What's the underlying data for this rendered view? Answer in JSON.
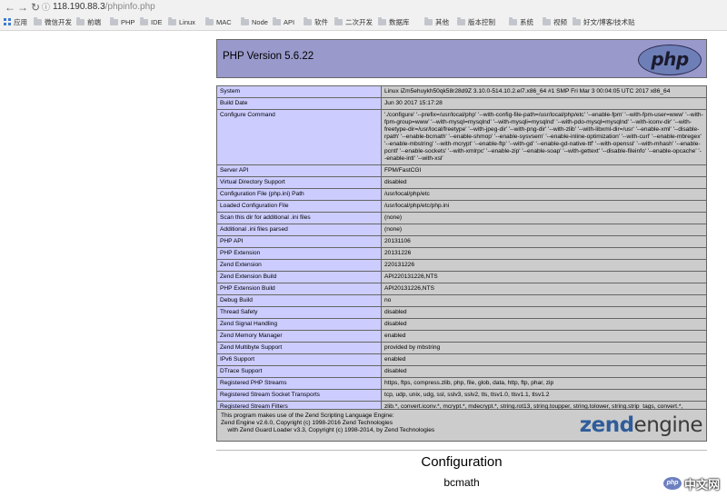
{
  "browser": {
    "url_host": "118.190.88.3",
    "url_path": "/phpinfo.php",
    "bookmarks": [
      "应用",
      "微信开发",
      "前端",
      "PHP",
      "IDE",
      "Linux",
      "MAC",
      "Node",
      "API",
      "软件",
      "二次开发",
      "数据库",
      "其他",
      "版本控制",
      "系统",
      "视频",
      "好文/博客/技术贴"
    ]
  },
  "header": {
    "version": "PHP Version 5.6.22",
    "logo_text": "php"
  },
  "info_rows": [
    {
      "k": "System",
      "v": "Linux iZm5ehuykh50qk58r28d9Z 3.10.0-514.10.2.el7.x86_64 #1 SMP Fri Mar 3 00:04:05 UTC 2017 x86_64"
    },
    {
      "k": "Build Date",
      "v": "Jun 30 2017 15:17:28"
    },
    {
      "k": "Configure Command",
      "v": " './configure' '--prefix=/usr/local/php' '--with-config-file-path=/usr/local/php/etc' '--enable-fpm' '--with-fpm-user=www' '--with-fpm-group=www' '--with-mysql=mysqlnd' '--with-mysqli=mysqlnd' '--with-pdo-mysql=mysqlnd' '--with-iconv-dir' '--with-freetype-dir=/usr/local/freetype' '--with-jpeg-dir' '--with-png-dir' '--with-zlib' '--with-libxml-dir=/usr' '--enable-xml' '--disable-rpath' '--enable-bcmath' '--enable-shmop' '--enable-sysvsem' '--enable-inline-optimization' '--with-curl' '--enable-mbregex' '--enable-mbstring' '--with-mcrypt' '--enable-ftp' '--with-gd' '--enable-gd-native-ttf' '--with-openssl' '--with-mhash' '--enable-pcntl' '--enable-sockets' '--with-xmlrpc' '--enable-zip' '--enable-soap' '--with-gettext' '--disable-fileinfo' '--enable-opcache' '--enable-intl' '--with-xsl'"
    },
    {
      "k": "Server API",
      "v": "FPM/FastCGI"
    },
    {
      "k": "Virtual Directory Support",
      "v": "disabled"
    },
    {
      "k": "Configuration File (php.ini) Path",
      "v": "/usr/local/php/etc"
    },
    {
      "k": "Loaded Configuration File",
      "v": "/usr/local/php/etc/php.ini"
    },
    {
      "k": "Scan this dir for additional .ini files",
      "v": "(none)"
    },
    {
      "k": "Additional .ini files parsed",
      "v": "(none)"
    },
    {
      "k": "PHP API",
      "v": "20131106"
    },
    {
      "k": "PHP Extension",
      "v": "20131226"
    },
    {
      "k": "Zend Extension",
      "v": "220131226"
    },
    {
      "k": "Zend Extension Build",
      "v": "API220131226,NTS"
    },
    {
      "k": "PHP Extension Build",
      "v": "API20131226,NTS"
    },
    {
      "k": "Debug Build",
      "v": "no"
    },
    {
      "k": "Thread Safety",
      "v": "disabled"
    },
    {
      "k": "Zend Signal Handling",
      "v": "disabled"
    },
    {
      "k": "Zend Memory Manager",
      "v": "enabled"
    },
    {
      "k": "Zend Multibyte Support",
      "v": "provided by mbstring"
    },
    {
      "k": "IPv6 Support",
      "v": "enabled"
    },
    {
      "k": "DTrace Support",
      "v": "disabled"
    },
    {
      "k": "Registered PHP Streams",
      "v": "https, ftps, compress.zlib, php, file, glob, data, http, ftp, phar, zip"
    },
    {
      "k": "Registered Stream Socket Transports",
      "v": "tcp, udp, unix, udg, ssl, sslv3, sslv2, tls, tlsv1.0, tlsv1.1, tlsv1.2"
    },
    {
      "k": "Registered Stream Filters",
      "v": "zlib.*, convert.iconv.*, mcrypt.*, mdecrypt.*, string.rot13, string.toupper, string.tolower, string.strip_tags, convert.*, consumed, dechunk"
    }
  ],
  "zend": {
    "line1": "This program makes use of the Zend Scripting Language Engine:",
    "line2": "Zend Engine v2.6.0, Copyright (c) 1998-2016 Zend Technologies",
    "line3": "    with Zend Guard Loader v3.3, Copyright (c) 1998-2014, by Zend Technologies",
    "logo_a": "zend",
    "logo_b": "engine"
  },
  "configuration": {
    "title": "Configuration",
    "first_module": "bcmath"
  },
  "watermark": {
    "badge": "php",
    "text": "中文网"
  }
}
